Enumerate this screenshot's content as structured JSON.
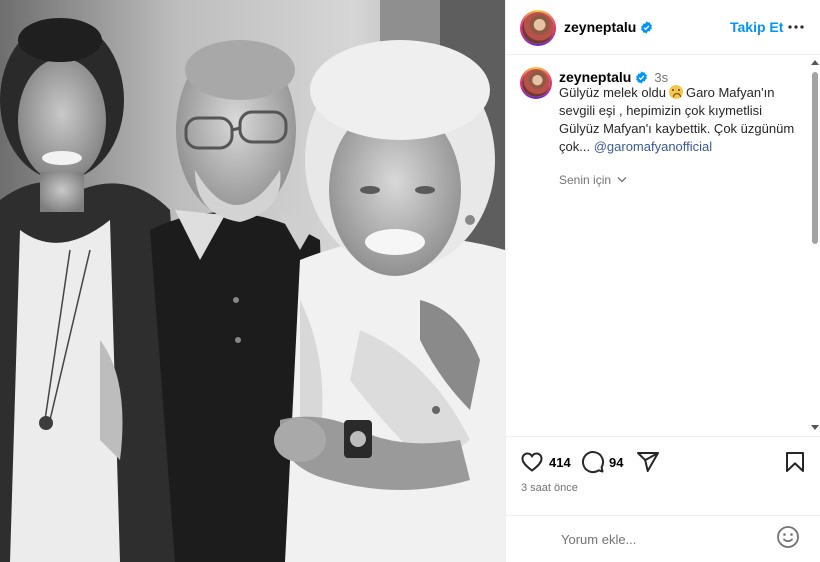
{
  "post": {
    "username": "zeyneptalu",
    "follow_label": "Takip Et",
    "more_icon": "more-horizontal-icon",
    "verified_icon": "verified-badge-icon"
  },
  "caption": {
    "username": "zeyneptalu",
    "time": "3s",
    "text_part1": "Gülyüz melek oldu",
    "emoji": "crying-face-emoji",
    "text_part2": "Garo Mafyan'ın sevgili eşi , hepimizin çok kıymetlisi Gülyüz Mafyan'ı kaybettik. Çok üzgünüm çok...",
    "mention": "@garomafyanofficial",
    "see_translation": "Senin için"
  },
  "actions": {
    "like_icon": "heart-icon",
    "likes": "414",
    "comment_icon": "comment-icon",
    "comments": "94",
    "share_icon": "send-icon",
    "save_icon": "bookmark-icon",
    "time_ago": "3 saat önce"
  },
  "comment_box": {
    "placeholder": "Yorum ekle...",
    "emoji_icon": "smiley-icon"
  },
  "colors": {
    "accent": "#0095f6",
    "mention": "#3b5998",
    "muted": "#737373",
    "border": "#efefef"
  }
}
